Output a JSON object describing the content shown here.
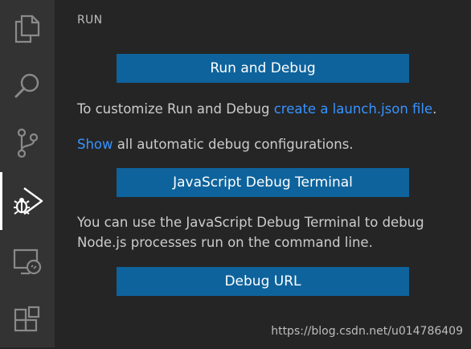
{
  "panel": {
    "title": "RUN"
  },
  "buttons": {
    "run_debug": "Run and Debug",
    "js_terminal": "JavaScript Debug Terminal",
    "debug_url": "Debug URL"
  },
  "customize": {
    "prefix": "To customize Run and Debug ",
    "link": "create a launch.json file",
    "suffix": "."
  },
  "show": {
    "link": "Show",
    "suffix": " all automatic debug configurations."
  },
  "terminal_desc": {
    "line1": "You can use the JavaScript Debug Terminal to debug",
    "line2": "Node.js processes run on the command line."
  },
  "watermark": "https://blog.csdn.net/u014786409",
  "activity_bar": {
    "icons": [
      "explorer-icon",
      "search-icon",
      "source-control-icon",
      "run-debug-icon",
      "remote-explorer-icon",
      "extensions-icon"
    ]
  },
  "colors": {
    "button_bg": "#0e639c",
    "link": "#3794ff",
    "activity_bar": "#333333",
    "panel_bg": "#252526"
  }
}
